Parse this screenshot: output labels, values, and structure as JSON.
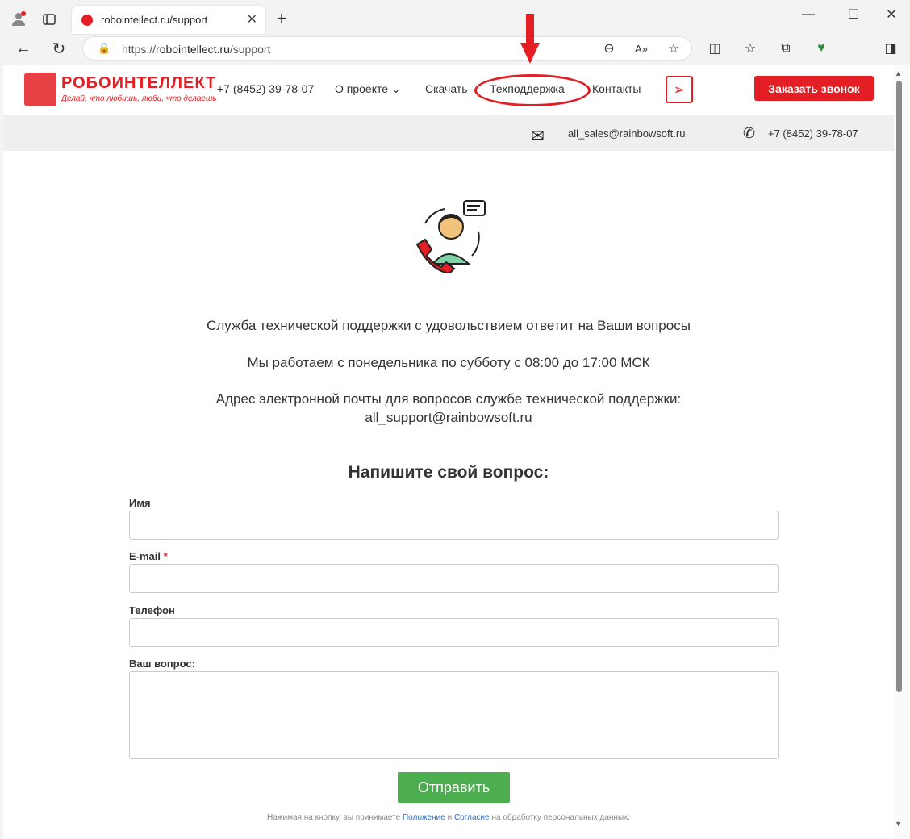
{
  "browser": {
    "tab_title": "robointellect.ru/support",
    "url_prefix": "https://",
    "url_host": "robointellect.ru",
    "url_path": "/support"
  },
  "site": {
    "logo_text": "РОБОИНТЕЛЛЕКТ",
    "logo_slogan": "Делай, что любишь, люби, что делаешь",
    "nav": {
      "phone": "+7 (8452) 39-78-07",
      "about": "О проекте",
      "download": "Скачать",
      "support": "Техподдержка",
      "contacts": "Контакты"
    },
    "cta_label": "Заказать звонок",
    "info": {
      "email": "all_sales@rainbowsoft.ru",
      "phone": "+7 (8452) 39-78-07"
    }
  },
  "content": {
    "line1": "Служба технической поддержки с удовольствием ответит на Ваши вопросы",
    "line2": "Мы работаем с понедельника по субботу с 08:00 до 17:00 МСК",
    "line3": "Адрес электронной почты для вопросов службе технической поддержки:",
    "line4": "all_support@rainbowsoft.ru",
    "form_title": "Напишите свой вопрос:",
    "fields": {
      "name_label": "Имя",
      "email_label": "E-mail",
      "email_required": "*",
      "phone_label": "Телефон",
      "question_label": "Ваш вопрос:"
    },
    "submit_label": "Отправить",
    "consent_prefix": "Нажимая на кнопку, вы принимаете ",
    "consent_link1": "Положение",
    "consent_and": " и ",
    "consent_link2": "Согласие",
    "consent_suffix": " на обработку персональных данных."
  },
  "colors": {
    "brand_red": "#e31e24",
    "submit_green": "#4cae4f"
  }
}
